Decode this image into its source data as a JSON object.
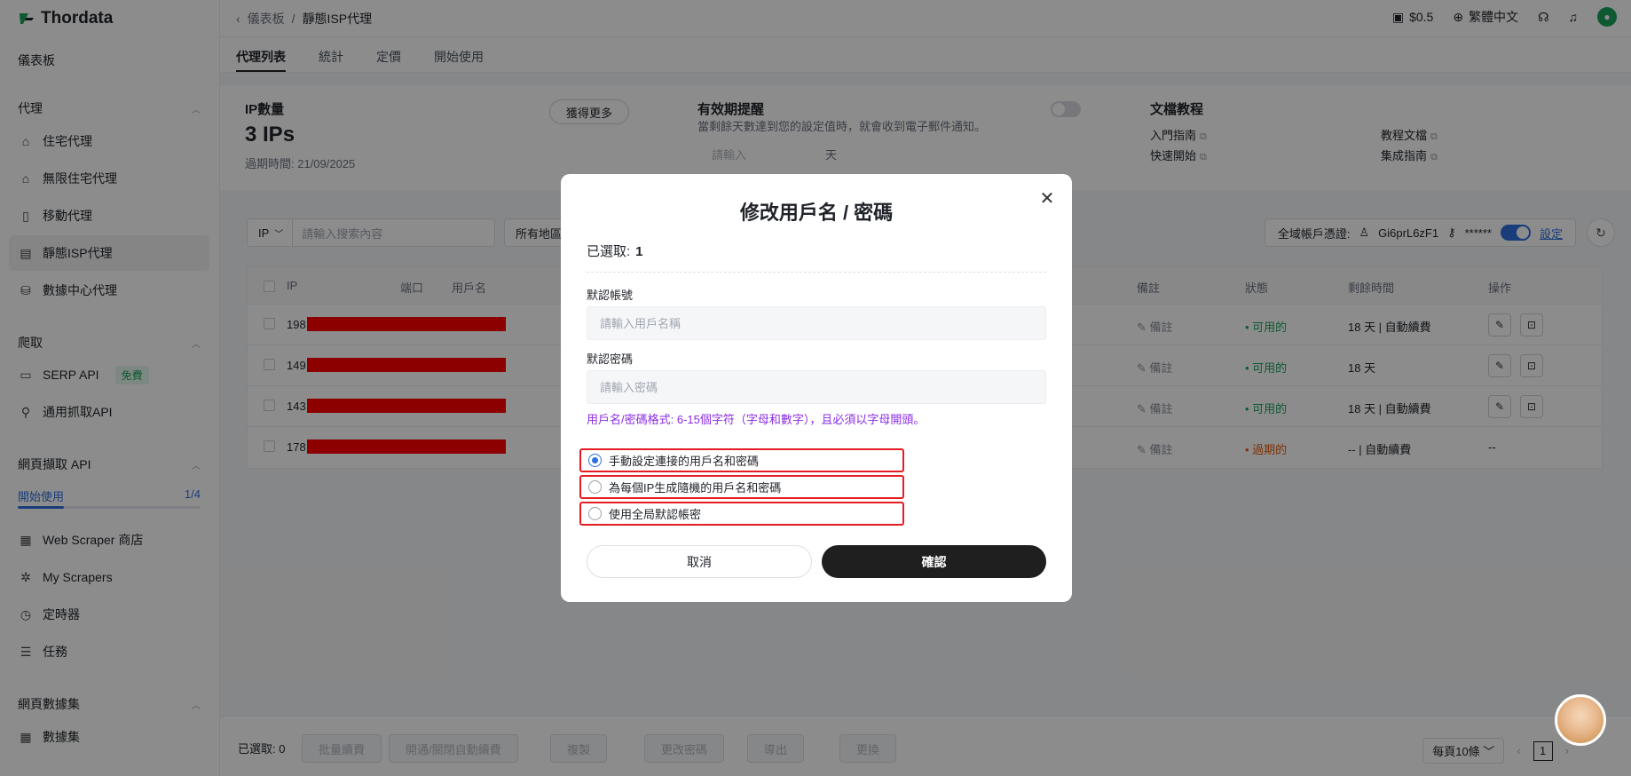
{
  "app": {
    "logo_text": "Thordata"
  },
  "sidebar": {
    "dashboard": "儀表板",
    "proxy_section": "代理",
    "proxy_items": [
      "住宅代理",
      "無限住宅代理",
      "移動代理",
      "靜態ISP代理",
      "數據中心代理"
    ],
    "scrape_section": "爬取",
    "serp": "SERP API",
    "free_badge": "免費",
    "general_api": "通用抓取API",
    "webscrape_section": "網頁擷取 API",
    "start_label": "開始使用",
    "start_progress": "1/4",
    "start_progress_value": 0.25,
    "webscrape_items": [
      "Web Scraper 商店",
      "My Scrapers",
      "定時器",
      "任務"
    ],
    "dataset_section": "網頁數據集",
    "dataset_item": "數據集"
  },
  "topbar": {
    "breadcrumb_root": "儀表板",
    "breadcrumb_sep": "/",
    "breadcrumb_current": "靜態ISP代理",
    "balance": "$0.5",
    "language": "繁體中文"
  },
  "tabs": [
    "代理列表",
    "統計",
    "定價",
    "開始使用"
  ],
  "summary": {
    "ip_count_label": "IP數量",
    "ip_count": "3 IPs",
    "expiry": "過期時間: 21/09/2025",
    "get_more": "獲得更多",
    "reminder_title": "有效期提醒",
    "reminder_desc": "當剩餘天數達到您的設定值時，就會收到電子郵件通知。",
    "reminder_placeholder": "請輸入",
    "reminder_unit": "天",
    "docs_title": "文檔教程",
    "docs_links": [
      "入門指南",
      "快速開始",
      "教程文檔",
      "集成指南"
    ]
  },
  "filter": {
    "type": "IP",
    "search_placeholder": "請輸入搜索內容",
    "region": "所有地區",
    "global_cred_label": "全域帳戶憑證:",
    "global_user": "Gi6prL6zF1",
    "global_pass": "******",
    "settings_link": "設定"
  },
  "table": {
    "headers": [
      "IP",
      "端口",
      "用戶名",
      "備註",
      "狀態",
      "剩餘時間",
      "操作"
    ],
    "rows": [
      {
        "ip": "198.",
        "remark": "備註",
        "status": "可用的",
        "remaining": "18 天 | 自動續費"
      },
      {
        "ip": "149.",
        "remark": "備註",
        "status": "可用的",
        "remaining": "18 天"
      },
      {
        "ip": "143.",
        "remark": "備註",
        "status": "可用的",
        "remaining": "18 天 | 自動續費"
      },
      {
        "ip": "178.",
        "remark": "備註",
        "status": "過期的",
        "remaining": "-- | 自動續費",
        "ops": "--"
      }
    ]
  },
  "bottombar": {
    "selected": "已選取: 0",
    "buttons": [
      "批量續費",
      "開通/關閉自動續費",
      "複製",
      "更改密碼",
      "導出",
      "更換"
    ],
    "per_page": "每頁10條",
    "page": "1"
  },
  "modal": {
    "title": "修改用戶名 / 密碼",
    "selected_label": "已選取:",
    "selected_count": "1",
    "username_label": "默認帳號",
    "username_placeholder": "請輸入用戶名稱",
    "password_label": "默認密碼",
    "password_placeholder": "請輸入密碼",
    "hint": "用戶名/密碼格式: 6-15個字符（字母和數字），且必須以字母開頭。",
    "options": [
      "手動設定連接的用戶名和密碼",
      "為每個IP生成隨機的用戶名和密碼",
      "使用全局默認帳密"
    ],
    "selected_option": 0,
    "cancel": "取消",
    "confirm": "確認"
  },
  "colors": {
    "accent": "#2f6fe0",
    "ok": "#1aa35c",
    "expired": "#e8590c",
    "highlight_border": "#e51c23",
    "hint": "#8a2be2"
  }
}
